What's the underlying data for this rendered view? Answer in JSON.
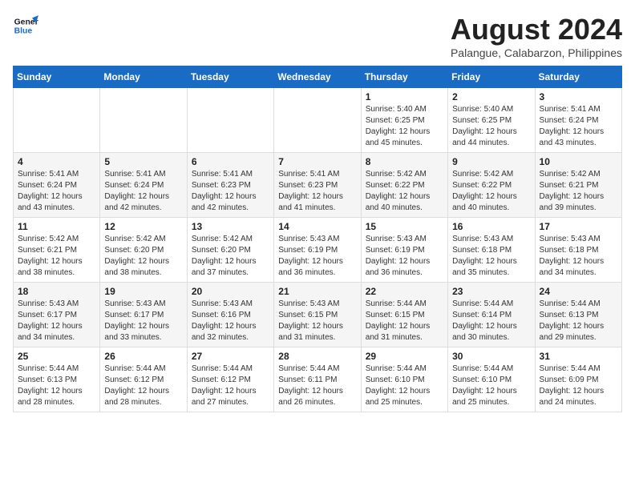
{
  "header": {
    "logo_line1": "General",
    "logo_line2": "Blue",
    "month_year": "August 2024",
    "location": "Palangue, Calabarzon, Philippines"
  },
  "days_of_week": [
    "Sunday",
    "Monday",
    "Tuesday",
    "Wednesday",
    "Thursday",
    "Friday",
    "Saturday"
  ],
  "weeks": [
    [
      {
        "num": "",
        "info": ""
      },
      {
        "num": "",
        "info": ""
      },
      {
        "num": "",
        "info": ""
      },
      {
        "num": "",
        "info": ""
      },
      {
        "num": "1",
        "info": "Sunrise: 5:40 AM\nSunset: 6:25 PM\nDaylight: 12 hours\nand 45 minutes."
      },
      {
        "num": "2",
        "info": "Sunrise: 5:40 AM\nSunset: 6:25 PM\nDaylight: 12 hours\nand 44 minutes."
      },
      {
        "num": "3",
        "info": "Sunrise: 5:41 AM\nSunset: 6:24 PM\nDaylight: 12 hours\nand 43 minutes."
      }
    ],
    [
      {
        "num": "4",
        "info": "Sunrise: 5:41 AM\nSunset: 6:24 PM\nDaylight: 12 hours\nand 43 minutes."
      },
      {
        "num": "5",
        "info": "Sunrise: 5:41 AM\nSunset: 6:24 PM\nDaylight: 12 hours\nand 42 minutes."
      },
      {
        "num": "6",
        "info": "Sunrise: 5:41 AM\nSunset: 6:23 PM\nDaylight: 12 hours\nand 42 minutes."
      },
      {
        "num": "7",
        "info": "Sunrise: 5:41 AM\nSunset: 6:23 PM\nDaylight: 12 hours\nand 41 minutes."
      },
      {
        "num": "8",
        "info": "Sunrise: 5:42 AM\nSunset: 6:22 PM\nDaylight: 12 hours\nand 40 minutes."
      },
      {
        "num": "9",
        "info": "Sunrise: 5:42 AM\nSunset: 6:22 PM\nDaylight: 12 hours\nand 40 minutes."
      },
      {
        "num": "10",
        "info": "Sunrise: 5:42 AM\nSunset: 6:21 PM\nDaylight: 12 hours\nand 39 minutes."
      }
    ],
    [
      {
        "num": "11",
        "info": "Sunrise: 5:42 AM\nSunset: 6:21 PM\nDaylight: 12 hours\nand 38 minutes."
      },
      {
        "num": "12",
        "info": "Sunrise: 5:42 AM\nSunset: 6:20 PM\nDaylight: 12 hours\nand 38 minutes."
      },
      {
        "num": "13",
        "info": "Sunrise: 5:42 AM\nSunset: 6:20 PM\nDaylight: 12 hours\nand 37 minutes."
      },
      {
        "num": "14",
        "info": "Sunrise: 5:43 AM\nSunset: 6:19 PM\nDaylight: 12 hours\nand 36 minutes."
      },
      {
        "num": "15",
        "info": "Sunrise: 5:43 AM\nSunset: 6:19 PM\nDaylight: 12 hours\nand 36 minutes."
      },
      {
        "num": "16",
        "info": "Sunrise: 5:43 AM\nSunset: 6:18 PM\nDaylight: 12 hours\nand 35 minutes."
      },
      {
        "num": "17",
        "info": "Sunrise: 5:43 AM\nSunset: 6:18 PM\nDaylight: 12 hours\nand 34 minutes."
      }
    ],
    [
      {
        "num": "18",
        "info": "Sunrise: 5:43 AM\nSunset: 6:17 PM\nDaylight: 12 hours\nand 34 minutes."
      },
      {
        "num": "19",
        "info": "Sunrise: 5:43 AM\nSunset: 6:17 PM\nDaylight: 12 hours\nand 33 minutes."
      },
      {
        "num": "20",
        "info": "Sunrise: 5:43 AM\nSunset: 6:16 PM\nDaylight: 12 hours\nand 32 minutes."
      },
      {
        "num": "21",
        "info": "Sunrise: 5:43 AM\nSunset: 6:15 PM\nDaylight: 12 hours\nand 31 minutes."
      },
      {
        "num": "22",
        "info": "Sunrise: 5:44 AM\nSunset: 6:15 PM\nDaylight: 12 hours\nand 31 minutes."
      },
      {
        "num": "23",
        "info": "Sunrise: 5:44 AM\nSunset: 6:14 PM\nDaylight: 12 hours\nand 30 minutes."
      },
      {
        "num": "24",
        "info": "Sunrise: 5:44 AM\nSunset: 6:13 PM\nDaylight: 12 hours\nand 29 minutes."
      }
    ],
    [
      {
        "num": "25",
        "info": "Sunrise: 5:44 AM\nSunset: 6:13 PM\nDaylight: 12 hours\nand 28 minutes."
      },
      {
        "num": "26",
        "info": "Sunrise: 5:44 AM\nSunset: 6:12 PM\nDaylight: 12 hours\nand 28 minutes."
      },
      {
        "num": "27",
        "info": "Sunrise: 5:44 AM\nSunset: 6:12 PM\nDaylight: 12 hours\nand 27 minutes."
      },
      {
        "num": "28",
        "info": "Sunrise: 5:44 AM\nSunset: 6:11 PM\nDaylight: 12 hours\nand 26 minutes."
      },
      {
        "num": "29",
        "info": "Sunrise: 5:44 AM\nSunset: 6:10 PM\nDaylight: 12 hours\nand 25 minutes."
      },
      {
        "num": "30",
        "info": "Sunrise: 5:44 AM\nSunset: 6:10 PM\nDaylight: 12 hours\nand 25 minutes."
      },
      {
        "num": "31",
        "info": "Sunrise: 5:44 AM\nSunset: 6:09 PM\nDaylight: 12 hours\nand 24 minutes."
      }
    ]
  ]
}
